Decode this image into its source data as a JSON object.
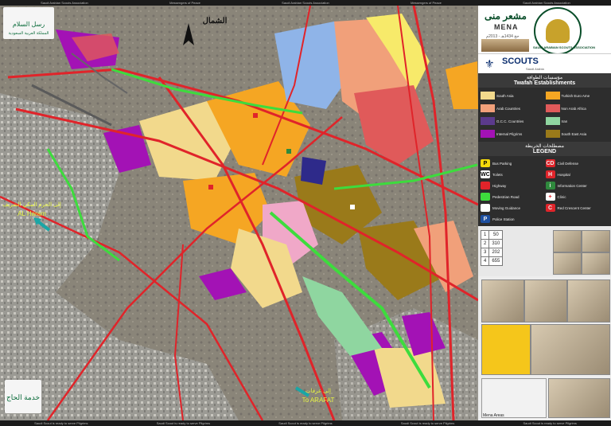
{
  "strip": {
    "top_items": [
      "Saudi Arabian Scouts Association",
      "Messengers of Peace",
      "Saudi Arabian Scouts Association",
      "Messengers of Peace",
      "Saudi Arabian Scouts Association"
    ],
    "bottom_items": [
      "Saudi Scout is ready to serve Pilgrims",
      "Saudi Scout is ready to serve Pilgrims",
      "Saudi Scout is ready to serve Pilgrims",
      "Saudi Scout is ready to serve Pilgrims",
      "Saudi Scout is ready to serve Pilgrims"
    ]
  },
  "map": {
    "north_label": "الشمال",
    "haram_label_ar": "إلى الحرم المكي الشريف",
    "haram_label_en": "AL Haram",
    "arafat_label_ar": "إلى عرفات",
    "arafat_label_en": "To ARAFAT",
    "logo_top_ar": "رسل السلام",
    "logo_top_en": "المملكة العربية السعودية",
    "logo_bottom_ar": "خدمة الحاج"
  },
  "header": {
    "title_ar": "مشعر منى",
    "title_en": "MENA",
    "season": "حج 1434هـ - 2013م",
    "association": "SAUDI ARABIAN SCOUTS ASSOCIATION"
  },
  "scouts": {
    "label": "SCOUTS",
    "sub": "Saudi Arabia"
  },
  "establishments": {
    "title_ar": "مؤسسات الطوافة",
    "title_en": "Twafah Establishments",
    "items": [
      {
        "label": "South Asia",
        "color": "#f2d98c"
      },
      {
        "label": "Turkish Euro Ame",
        "color": "#f5a623"
      },
      {
        "label": "Arab Countries",
        "color": "#f1a07a"
      },
      {
        "label": "Non Arab Africa",
        "color": "#e05a5a"
      },
      {
        "label": "G.C.C. Countries",
        "color": "#5b3a8c"
      },
      {
        "label": "Iran",
        "color": "#8fd6a0"
      },
      {
        "label": "Internal Pilgrims",
        "color": "#a312b5"
      },
      {
        "label": "South East Asia",
        "color": "#9a7a1a"
      }
    ]
  },
  "legend": {
    "title_ar": "مصطلحات الخريطة",
    "title_en": "LEGEND",
    "items": [
      {
        "label": "Bus Parking",
        "icon": "P",
        "color": "#f5d90a"
      },
      {
        "label": "Civil Defense",
        "icon": "CD",
        "color": "#e0242a"
      },
      {
        "label": "Toilets",
        "icon": "WC",
        "color": "#ffffff"
      },
      {
        "label": "Hospital",
        "icon": "H",
        "color": "#e0242a"
      },
      {
        "label": "Highway",
        "icon": "",
        "color": "#e0242a"
      },
      {
        "label": "Information Center",
        "icon": "i",
        "color": "#2f8a3d"
      },
      {
        "label": "Pedestrian Road",
        "icon": "",
        "color": "#3ddc3d"
      },
      {
        "label": "Clinic",
        "icon": "+",
        "color": "#ffffff"
      },
      {
        "label": "Moving Guidance",
        "icon": "",
        "color": "#ffffff"
      },
      {
        "label": "Red Crescent Center",
        "icon": "C",
        "color": "#e0242a"
      },
      {
        "label": "Police Station",
        "icon": "P",
        "color": "#1d4fa0"
      }
    ]
  },
  "grid_table": {
    "rows": [
      {
        "name": "",
        "code": "1",
        "value": "50"
      },
      {
        "name": "",
        "code": "2",
        "value": "310"
      },
      {
        "name": "",
        "code": "3",
        "value": "202"
      },
      {
        "name": "",
        "code": "4",
        "value": "655"
      }
    ]
  },
  "mini_map": {
    "label": "Mena Areas"
  }
}
